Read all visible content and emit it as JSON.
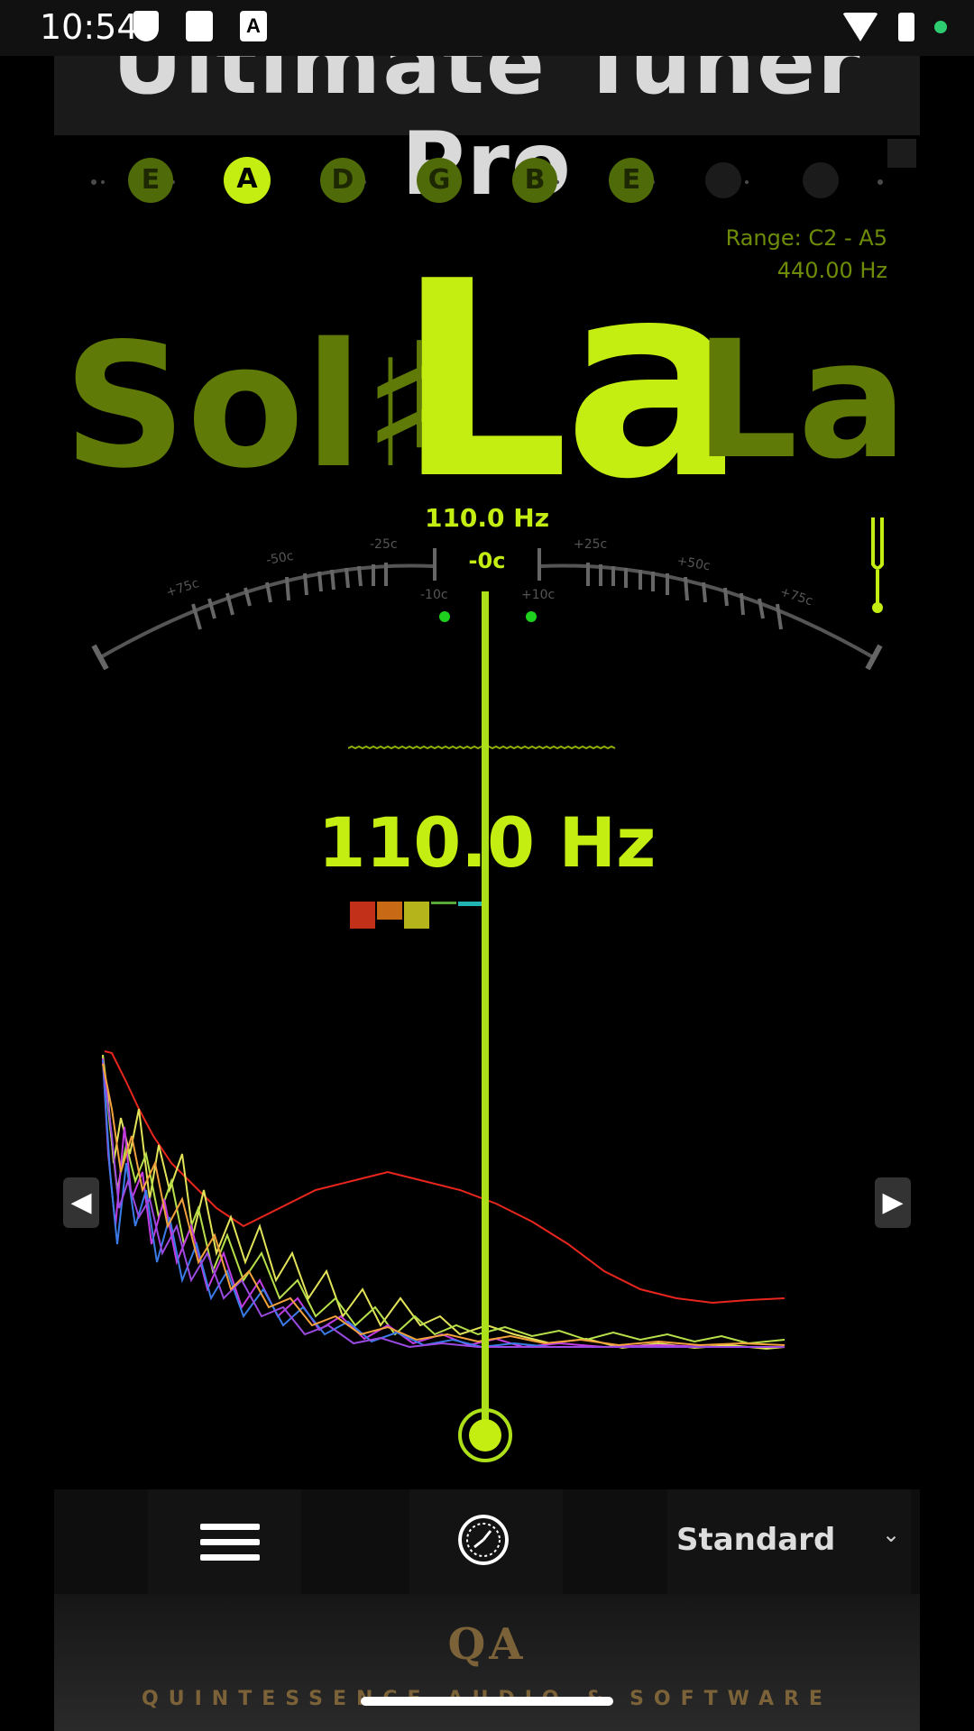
{
  "status_bar": {
    "time": "10:54",
    "icons": [
      "shield-icon",
      "sd-card-icon",
      "font-a-icon",
      "wifi-icon",
      "battery-icon",
      "green-dot-icon"
    ]
  },
  "app": {
    "title": "Ultimate Tuner Pro"
  },
  "strings": [
    {
      "label": "E",
      "active": false
    },
    {
      "label": "A",
      "active": true
    },
    {
      "label": "D",
      "active": false
    },
    {
      "label": "G",
      "active": false
    },
    {
      "label": "B",
      "active": false
    },
    {
      "label": "E",
      "active": false
    },
    {
      "label": "",
      "active": false
    },
    {
      "label": "",
      "active": false
    }
  ],
  "info": {
    "range": "Range: C2 - A5",
    "reference": "440.00 Hz"
  },
  "notes": {
    "previous": "Sol♯",
    "current": "La",
    "next": "La♯"
  },
  "meter": {
    "frequency_label": "110.0 Hz",
    "cents_label": "-0c",
    "scale_labels": [
      "+75c",
      "-50c",
      "-25c",
      "-10c",
      "+10c",
      "+25c",
      "+50c",
      "+75c"
    ]
  },
  "readout": {
    "frequency": "110.0 Hz"
  },
  "nav": {
    "left_arrow": "◀",
    "right_arrow": "▶"
  },
  "bottom_bar": {
    "tuning": "Standard",
    "chevron": "⌄"
  },
  "footer": {
    "logo": "QA",
    "company": "QUINTESSENCE AUDIO & SOFTWARE"
  },
  "colors": {
    "accent": "#c4ee12",
    "dim_accent": "#5f7a06",
    "spectrum_red": "#e8261e",
    "footer_gold": "#7c6238"
  }
}
